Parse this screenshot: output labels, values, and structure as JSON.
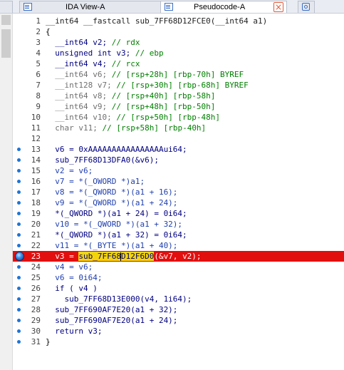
{
  "tabs": [
    {
      "label": "IDA View-A",
      "close": "×"
    },
    {
      "label": "Pseudocode-A",
      "close": "×"
    }
  ],
  "code": {
    "signature": "__int64 __fastcall sub_7FF68D12FCE0(__int64 a1)",
    "lines": [
      {
        "n": "1",
        "text": "__int64 __fastcall sub_7FF68D12FCE0(__int64 a1)"
      },
      {
        "n": "2",
        "text": "{"
      },
      {
        "n": "3",
        "text": "  __int64 v2; // rdx"
      },
      {
        "n": "4",
        "text": "  unsigned int v3; // ebp"
      },
      {
        "n": "5",
        "text": "  __int64 v4; // rcx"
      },
      {
        "n": "6",
        "text": "  __int64 v6; // [rsp+28h] [rbp-70h] BYREF"
      },
      {
        "n": "7",
        "text": "  __int128 v7; // [rsp+30h] [rbp-68h] BYREF"
      },
      {
        "n": "8",
        "text": "  __int64 v8; // [rsp+40h] [rbp-58h]"
      },
      {
        "n": "9",
        "text": "  __int64 v9; // [rsp+48h] [rbp-50h]"
      },
      {
        "n": "10",
        "text": "  __int64 v10; // [rsp+50h] [rbp-48h]"
      },
      {
        "n": "11",
        "text": "  char v11; // [rsp+58h] [rbp-40h]"
      },
      {
        "n": "12",
        "text": ""
      },
      {
        "n": "13",
        "text": "  v6 = 0xAAAAAAAAAAAAAAAAui64;"
      },
      {
        "n": "14",
        "text": "  sub_7FF68D13DFA0(&v6);"
      },
      {
        "n": "15",
        "text": "  v2 = v6;"
      },
      {
        "n": "16",
        "text": "  v7 = *(_OWORD *)a1;"
      },
      {
        "n": "17",
        "text": "  v8 = *(_QWORD *)(a1 + 16);"
      },
      {
        "n": "18",
        "text": "  v9 = *(_QWORD *)(a1 + 24);"
      },
      {
        "n": "19",
        "text": "  *(_QWORD *)(a1 + 24) = 0i64;"
      },
      {
        "n": "20",
        "text": "  v10 = *(_QWORD *)(a1 + 32);"
      },
      {
        "n": "21",
        "text": "  *(_QWORD *)(a1 + 32) = 0i64;"
      },
      {
        "n": "22",
        "text": "  v11 = *(_BYTE *)(a1 + 40);"
      },
      {
        "n": "23",
        "text": "  v3 = sub_7FF68D12F6D0(&v7, v2);"
      },
      {
        "n": "24",
        "text": "  v4 = v6;"
      },
      {
        "n": "25",
        "text": "  v6 = 0i64;"
      },
      {
        "n": "26",
        "text": "  if ( v4 )"
      },
      {
        "n": "27",
        "text": "    sub_7FF68D13E000(v4, 1i64);"
      },
      {
        "n": "28",
        "text": "  sub_7FF690AF7E20(a1 + 32);"
      },
      {
        "n": "29",
        "text": "  sub_7FF690AF7E20(a1 + 24);"
      },
      {
        "n": "30",
        "text": "  return v3;"
      },
      {
        "n": "31",
        "text": "}"
      }
    ]
  },
  "highlight_line": "23",
  "colors": {
    "highlight": "#e20f0f",
    "marker": "#f4d50d",
    "comment": "#008000",
    "variable": "#1f3fae"
  }
}
